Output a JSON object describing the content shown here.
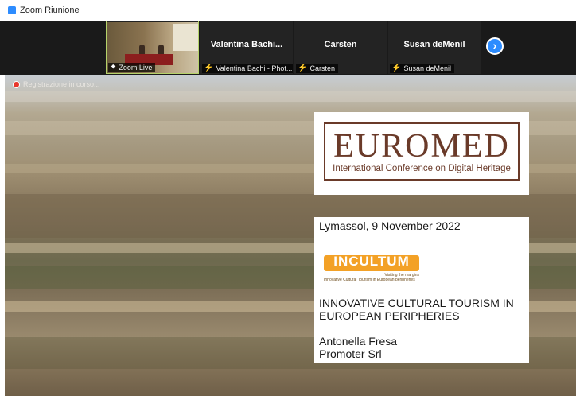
{
  "window": {
    "title": "Zoom Riunione"
  },
  "participants": [
    {
      "name": "",
      "footer": "Zoom Live",
      "footer_icon": "camera-icon",
      "active": true
    },
    {
      "name": "Valentina  Bachi...",
      "footer": "Valentina Bachi - Phot...",
      "footer_icon": "mic-muted-icon"
    },
    {
      "name": "Carsten",
      "footer": "Carsten",
      "footer_icon": "mic-muted-icon"
    },
    {
      "name": "Susan deMenil",
      "footer": "Susan deMenil",
      "footer_icon": "mic-muted-icon"
    }
  ],
  "nav": {
    "next_icon": "chevron-right-icon",
    "next_glyph": "›"
  },
  "recording": {
    "label": "Registrazione in corso..."
  },
  "slide": {
    "logo_word": "EUROMED",
    "logo_subtitle": "International Conference on Digital Heritage",
    "location_date": "Lymassol, 9 November 2022",
    "project_logo": {
      "word": "INCULTUM",
      "tagline_1": "Visiting the margins",
      "tagline_2": "Innovative Cultural Tourism in European peripheries"
    },
    "talk_title_line1": "INNOVATIVE CULTURAL TOURISM IN",
    "talk_title_line2": "EUROPEAN PERIPHERIES",
    "speaker": "Antonella Fresa",
    "organization": "Promoter Srl"
  },
  "colors": {
    "accent": "#2d8cff",
    "muted": "#e8372c",
    "euromed": "#6a3a29",
    "incultum": "#f3a126"
  }
}
